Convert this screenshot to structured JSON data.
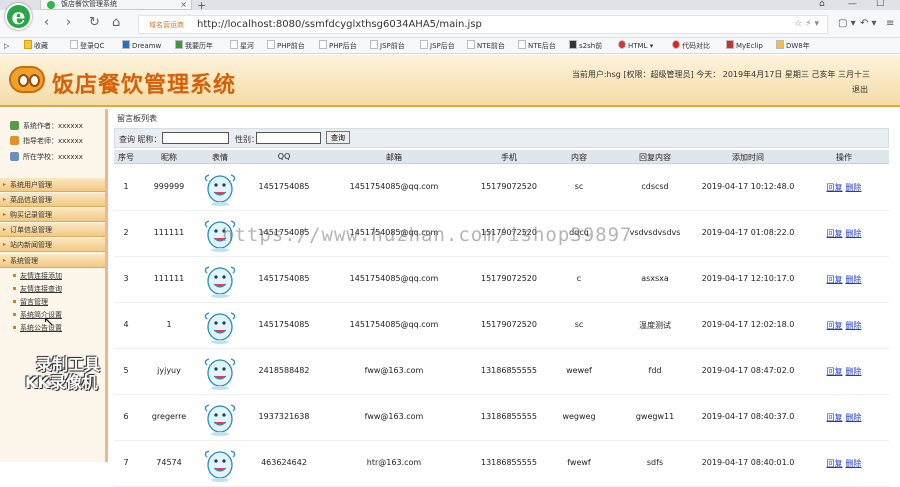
{
  "browser": {
    "tab_title": "饭店餐饮管理系统",
    "new_tab": "+",
    "url_badge": "域名营运商",
    "url": "http://localhost:8080/ssmfdcyglxthsg6034AHA5/main.jsp",
    "bookmarks": [
      "收藏",
      "登录QC",
      "Dreamw",
      "我要历年",
      "星河",
      "PHP前台",
      "PHP后台",
      "JSP前台",
      "JSP后台",
      "NTE前台",
      "NTE后台",
      "s2sh前",
      "HTML",
      "代码对比",
      "MyEclip",
      "DW8年"
    ]
  },
  "header": {
    "title": "饭店餐饮管理系统",
    "user_info": "当前用户:hsg [权限：超级管理员] 今天： 2019年4月17日 星期三 己亥年 三月十三",
    "exit_label": "退出"
  },
  "sidebar": {
    "info": [
      "系统作者：xxxxxx",
      "指导老师：xxxxxx",
      "所在学校：xxxxxx"
    ],
    "menus": [
      "系统用户管理",
      "菜品信息管理",
      "购买记录管理",
      "订单信息管理",
      "站内新闻管理",
      "系统管理"
    ],
    "sub_items": [
      "友情连接添加",
      "友情连接查询",
      "留言管理",
      "系统简介设置",
      "系统公告设置"
    ]
  },
  "watermark": {
    "line1": "录制工具",
    "line2": "KK录像机",
    "site": "https://www.huzhan.com/ishop39897"
  },
  "main": {
    "list_title": "留言板列表",
    "search": {
      "query_label": "查询 昵称：",
      "gender_label": "性别：",
      "button": "查询"
    },
    "columns": [
      "序号",
      "昵称",
      "表情",
      "QQ",
      "邮箱",
      "手机",
      "内容",
      "回复内容",
      "添加时间",
      "操作"
    ],
    "rows": [
      {
        "no": "1",
        "nickname": "999999",
        "qq": "1451754085",
        "email": "1451754085@qq.com",
        "phone": "15179072520",
        "content": "sc",
        "reply": "cdscsd",
        "time": "2019-04-17 10:12:48.0",
        "reply_btn": "回复",
        "delete_btn": "删除"
      },
      {
        "no": "2",
        "nickname": "111111",
        "qq": "1451754085",
        "email": "1451754085@qq.com",
        "phone": "15179072520",
        "content": "dqcq",
        "reply": "vsdvsdvsdvs",
        "time": "2019-04-17 01:08:22.0",
        "reply_btn": "回复",
        "delete_btn": "删除"
      },
      {
        "no": "3",
        "nickname": "111111",
        "qq": "1451754085",
        "email": "1451754085@qq.com",
        "phone": "15179072520",
        "content": "c",
        "reply": "asxsxa",
        "time": "2019-04-17 12:10:17.0",
        "reply_btn": "回复",
        "delete_btn": "删除"
      },
      {
        "no": "4",
        "nickname": "1",
        "qq": "1451754085",
        "email": "1451754085@qq.com",
        "phone": "15179072520",
        "content": "sc",
        "reply": "温度测试",
        "time": "2019-04-17 12:02:18.0",
        "reply_btn": "回复",
        "delete_btn": "删除"
      },
      {
        "no": "5",
        "nickname": "jyjyuy",
        "qq": "2418588482",
        "email": "fww@163.com",
        "phone": "13186855555",
        "content": "wewef",
        "reply": "fdd",
        "time": "2019-04-17 08:47:02.0",
        "reply_btn": "回复",
        "delete_btn": "删除"
      },
      {
        "no": "6",
        "nickname": "gregerre",
        "qq": "1937321638",
        "email": "fww@163.com",
        "phone": "13186855555",
        "content": "wegweg",
        "reply": "gwegw11",
        "time": "2019-04-17 08:40:37.0",
        "reply_btn": "回复",
        "delete_btn": "删除"
      },
      {
        "no": "7",
        "nickname": "74574",
        "qq": "463624642",
        "email": "htr@163.com",
        "phone": "13186855555",
        "content": "fwewf",
        "reply": "sdfs",
        "time": "2019-04-17 08:40:01.0",
        "reply_btn": "回复",
        "delete_btn": "删除"
      }
    ]
  }
}
